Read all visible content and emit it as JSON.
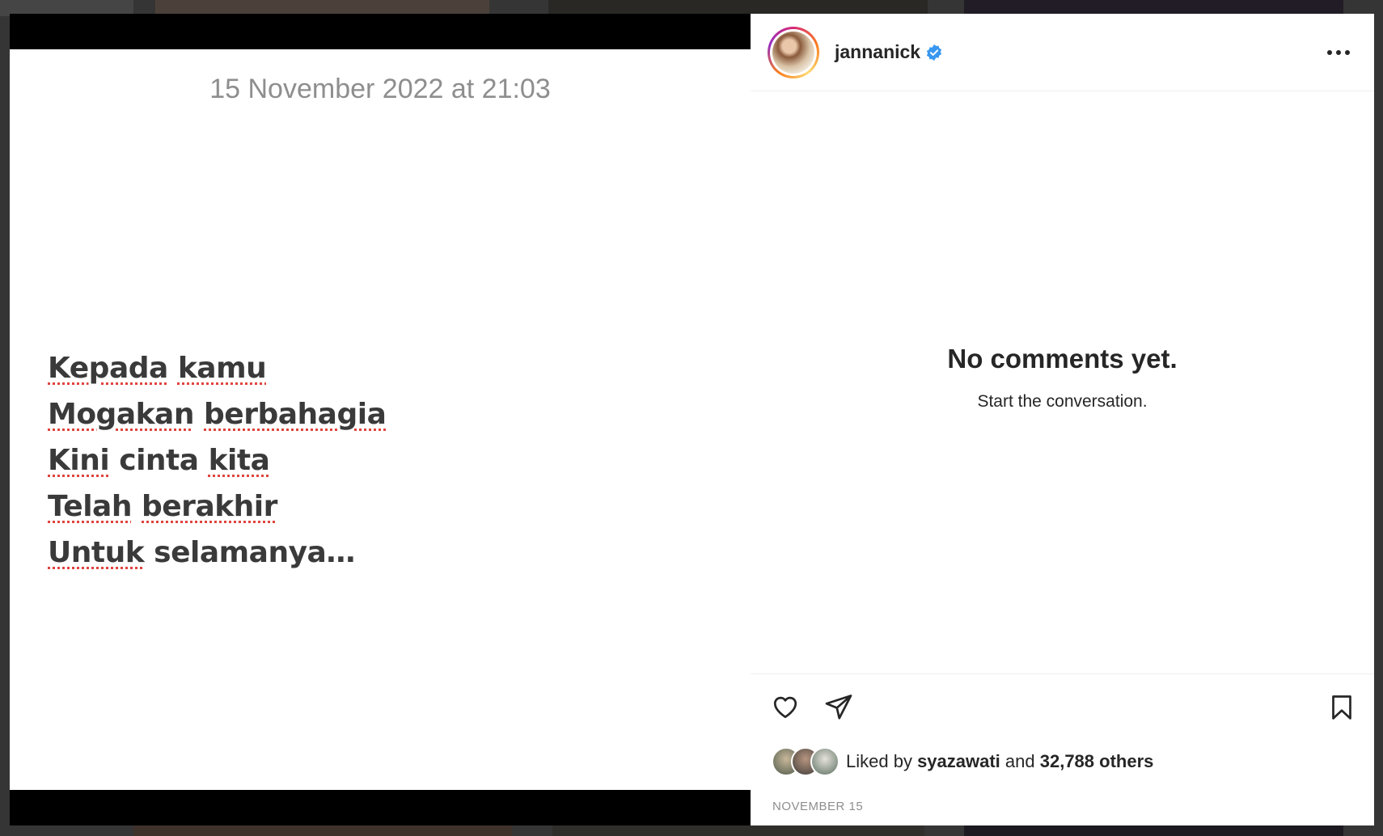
{
  "post": {
    "note_date": "15 November 2022 at 21:03",
    "note_lines": [
      [
        "Kepada",
        " ",
        "kamu"
      ],
      [
        "Mogakan",
        " ",
        "berbahagia"
      ],
      [
        "Kini",
        " cinta ",
        "kita"
      ],
      [
        "Telah",
        " ",
        "berakhir"
      ],
      [
        "Untuk",
        " selamanya…",
        ""
      ]
    ]
  },
  "header": {
    "username": "jannanick",
    "verified_icon": "verified-badge-icon",
    "more_icon": "more-options-icon"
  },
  "comments": {
    "empty_title": "No comments yet.",
    "empty_subtitle": "Start the conversation."
  },
  "actions": {
    "like_icon": "heart-icon",
    "share_icon": "paper-plane-icon",
    "save_icon": "bookmark-icon"
  },
  "likes": {
    "prefix": "Liked by ",
    "user": "syazawati",
    "middle": " and ",
    "others": "32,788 others"
  },
  "date_label": "NOVEMBER 15",
  "colors": {
    "verified": "#3897f0",
    "text": "#262626",
    "muted": "#8e8e8e",
    "spellcheck": "#e0443e"
  }
}
